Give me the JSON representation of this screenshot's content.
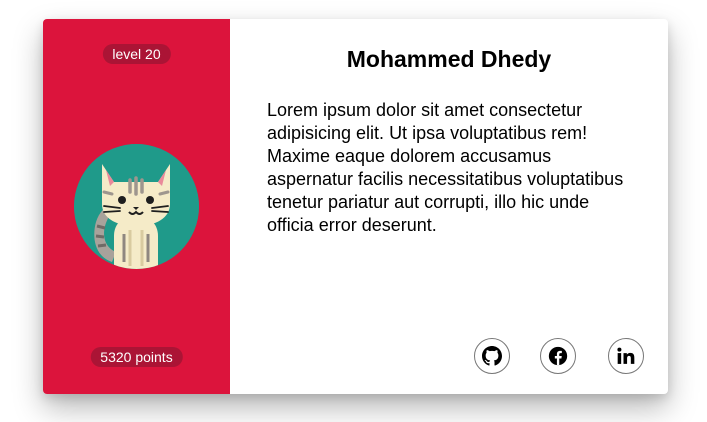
{
  "profile": {
    "level": "level 20",
    "points": "5320 points",
    "name": "Mohammed Dhedy",
    "bio": "Lorem ipsum dolor sit amet consectetur adipisicing elit. Ut ipsa voluptatibus rem! Maxime eaque dolorem accusamus aspernatur facilis necessitatibus voluptatibus tenetur pariatur aut corrupti, illo hic unde officia error deserunt."
  },
  "avatar": {
    "icon": "cat-icon"
  },
  "social": [
    {
      "icon": "github-icon"
    },
    {
      "icon": "facebook-icon"
    },
    {
      "icon": "linkedin-icon"
    }
  ],
  "colors": {
    "left_panel": "#dc143c",
    "avatar_bg": "#1f9a8a",
    "card_bg": "#ffffff"
  }
}
